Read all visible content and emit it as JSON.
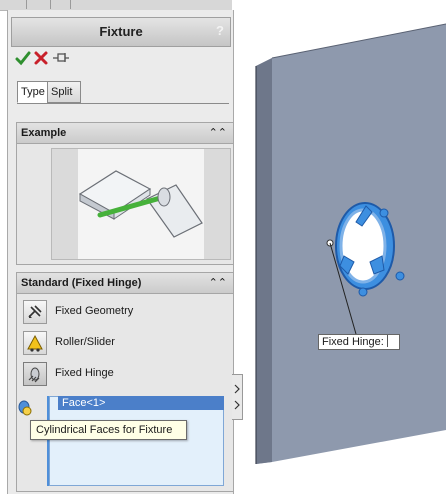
{
  "panel": {
    "title": "Fixture",
    "help_label": "?",
    "actions": [
      {
        "name": "ok",
        "icon": "check-icon",
        "color": "#2f8f2f"
      },
      {
        "name": "cancel",
        "icon": "x-icon",
        "color": "#c8202a"
      },
      {
        "name": "pin",
        "icon": "pushpin-icon",
        "color": "#555555"
      }
    ],
    "tabs": [
      {
        "label": "Type",
        "selected": true
      },
      {
        "label": "Split",
        "selected": false
      }
    ]
  },
  "example_group": {
    "title": "Example",
    "collapse_icon": "double-chevron-up-icon",
    "image_icon": "hinged-plates-example-icon",
    "accent_color": "#46b13a"
  },
  "standard_group": {
    "title": "Standard (Fixed Hinge)",
    "collapse_icon": "double-chevron-up-icon",
    "options": [
      {
        "label": "Fixed Geometry",
        "icon": "fixed-geometry-icon",
        "selected": false
      },
      {
        "label": "Roller/Slider",
        "icon": "roller-slider-icon",
        "selected": false
      },
      {
        "label": "Fixed Hinge",
        "icon": "fixed-hinge-icon",
        "selected": true
      }
    ],
    "selection_list": {
      "items": [
        "Face<1>"
      ],
      "icon": "cylindrical-faces-icon"
    },
    "tooltip": "Cylindrical Faces for Fixture"
  },
  "graphics": {
    "plate_color": "#8e99ad",
    "edge_color": "#6e778a",
    "highlight_color": "#3d8fe0",
    "callout_label": "Fixed Hinge:"
  }
}
